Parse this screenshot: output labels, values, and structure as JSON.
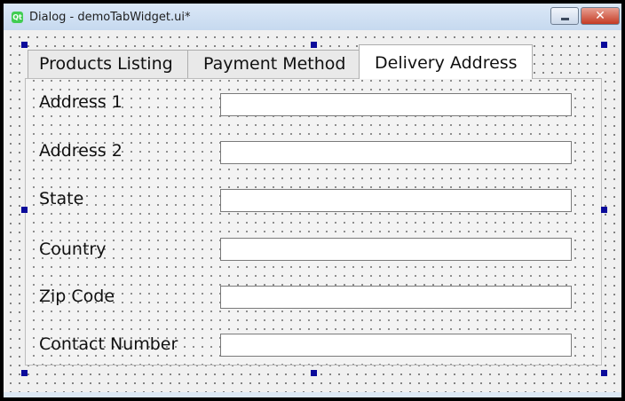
{
  "window": {
    "title": "Dialog - demoTabWidget.ui*",
    "app_icon_text": "Qt",
    "minimize_glyph": "",
    "close_glyph": "✕"
  },
  "tabs": [
    {
      "label": "Products Listing",
      "active": false
    },
    {
      "label": "Payment Method",
      "active": false
    },
    {
      "label": "Delivery Address",
      "active": true
    }
  ],
  "form": {
    "fields": [
      {
        "label": "Address 1",
        "value": ""
      },
      {
        "label": "Address 2",
        "value": ""
      },
      {
        "label": "State",
        "value": ""
      },
      {
        "label": "Country",
        "value": ""
      },
      {
        "label": "Zip Code",
        "value": ""
      },
      {
        "label": "Contact Number",
        "value": ""
      }
    ]
  },
  "colors": {
    "selection_handle": "#0a0a9a",
    "close_button": "#c43a24",
    "qt_logo": "#41cd52"
  }
}
